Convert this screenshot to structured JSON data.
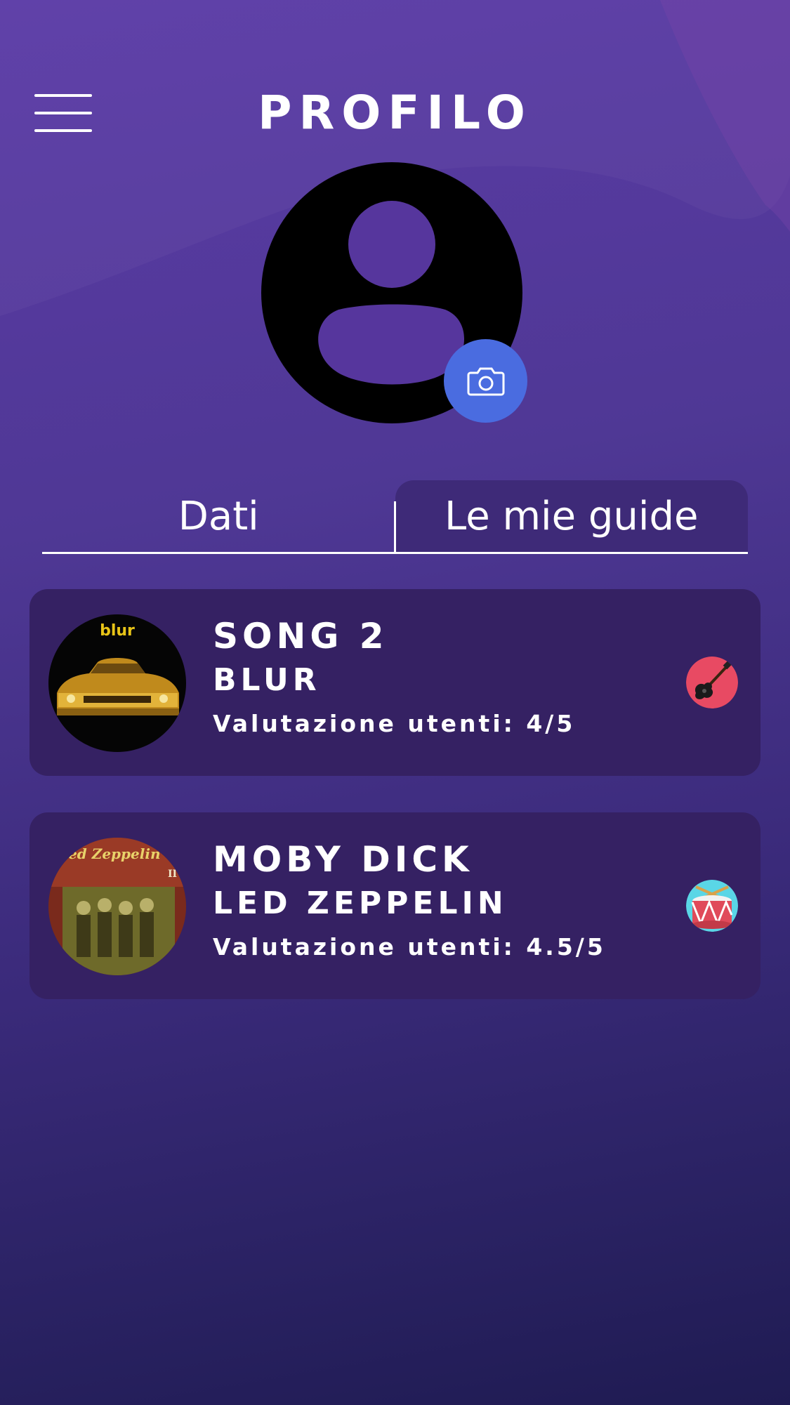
{
  "header": {
    "title": "PROFILO"
  },
  "tabs": [
    {
      "label": "Dati",
      "active": false
    },
    {
      "label": "Le mie guide",
      "active": true
    }
  ],
  "guides": [
    {
      "song": "SONG 2",
      "artist": "BLUR",
      "rating_label": "Valutazione utenti: 4/5",
      "cover_text": "blur",
      "instrument": "guitar-icon"
    },
    {
      "song": "MOBY DICK",
      "artist": "LED ZEPPELIN",
      "rating_label": "Valutazione utenti: 4.5/5",
      "cover_text": "Led Zeppelin",
      "instrument": "drum-icon"
    }
  ],
  "colors": {
    "background_top": "#5b3ba6",
    "background_bottom": "#1f1b52",
    "card": "#352163",
    "camera_button": "#4a6ce0",
    "guitar_badge": "#e84a63",
    "drum_badge": "#5ad6e6"
  }
}
